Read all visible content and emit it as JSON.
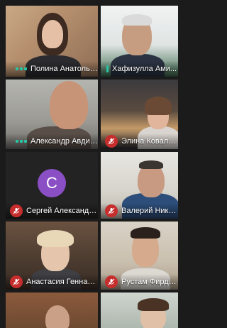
{
  "participants": [
    {
      "name": "Полина Анатолье...",
      "state": "speaking"
    },
    {
      "name": "Хафизулла Ами...",
      "state": "speaking"
    },
    {
      "name": "Александр Авдие...",
      "state": "speaking"
    },
    {
      "name": "Элина Ковален...",
      "state": "muted"
    },
    {
      "name": "Сергей Александр...",
      "state": "muted",
      "avatar_letter": "С"
    },
    {
      "name": "Валерий Никол...",
      "state": "muted"
    },
    {
      "name": "Анастасия Геннад...",
      "state": "muted"
    },
    {
      "name": "Рустам Фирдав...",
      "state": "muted"
    }
  ],
  "colors": {
    "speaking_indicator": "#27c5a3",
    "mute_badge": "#c62d2d",
    "avatar_bg": "#8a4fc4",
    "background": "#1b1b1b"
  },
  "icons": {
    "mute": "microphone-muted-icon",
    "speaking": "speaking-indicator-icon"
  }
}
